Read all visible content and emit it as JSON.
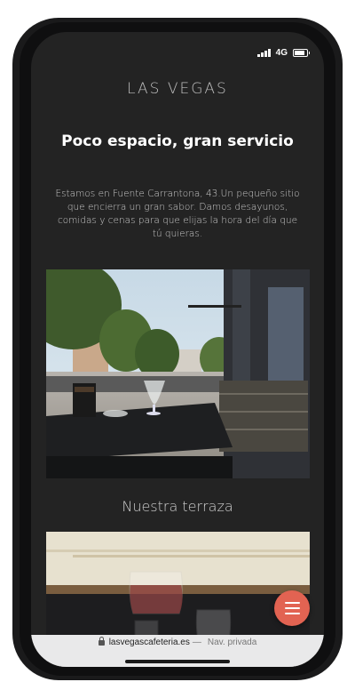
{
  "status_bar": {
    "network": "4G",
    "signal_bars": 4,
    "battery_level": 0.85,
    "icons": [
      "signal-icon",
      "battery-icon"
    ]
  },
  "site": {
    "logo_text": "LAS VEGAS",
    "headline": "Poco espacio, gran servicio",
    "intro": "Estamos en Fuente Carrantona, 43.Un pequeño sitio que encierra un gran sabor. Damos desayunos, comidas y cenas para que elijas la hora del día que tú quieras.",
    "section_title": "Nuestra terraza",
    "accent_color": "#e26352",
    "background_color": "#232323"
  },
  "menu_button": {
    "icon": "hamburger-menu-icon"
  },
  "browser": {
    "url": "lasvegascafeteria.es",
    "separator": "—",
    "mode": "Nav. privada",
    "icon": "lock-icon"
  }
}
